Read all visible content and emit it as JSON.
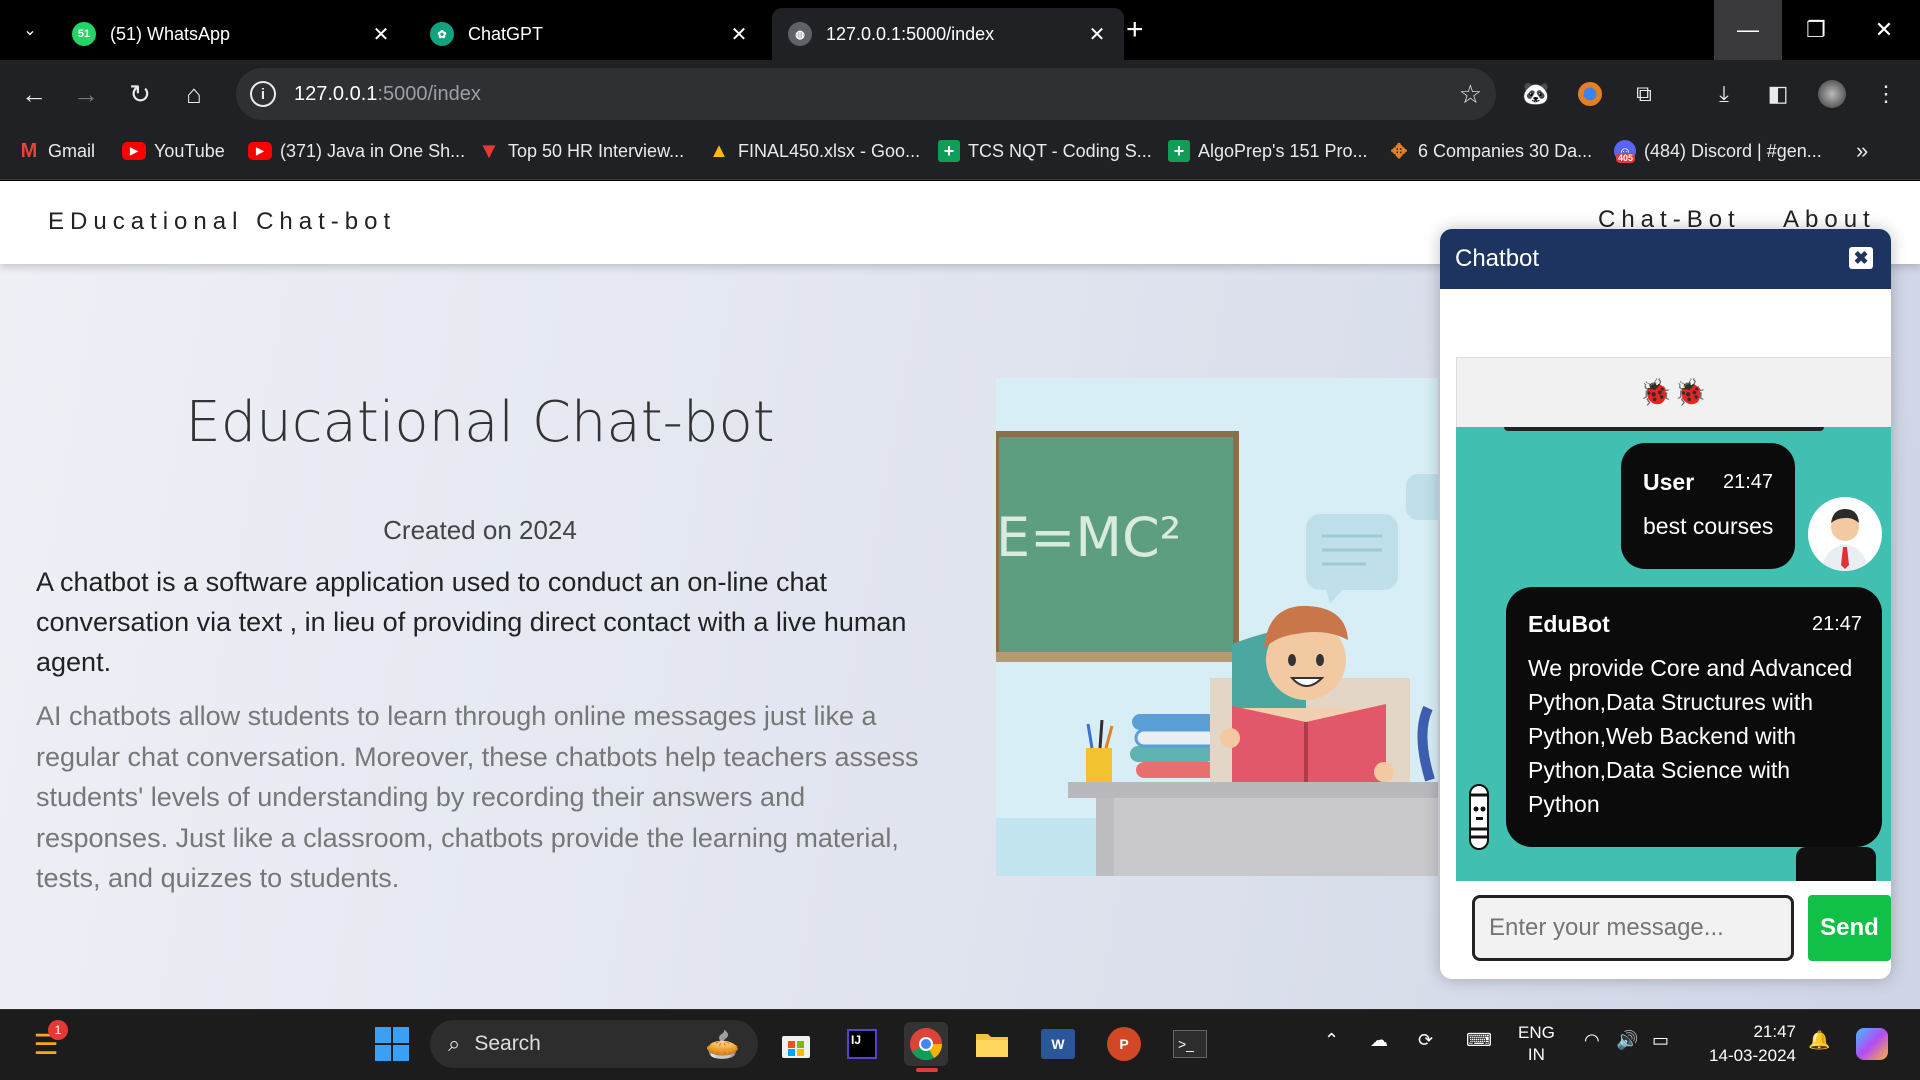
{
  "browser": {
    "tabs": [
      {
        "title": "(51) WhatsApp",
        "favicon": "whatsapp-icon",
        "badge": "51",
        "active": false
      },
      {
        "title": "ChatGPT",
        "favicon": "chatgpt-icon",
        "active": false
      },
      {
        "title": "127.0.0.1:5000/index",
        "favicon": "globe-icon",
        "active": true
      }
    ],
    "address": {
      "host": "127.0.0.1",
      "path": ":5000/index"
    },
    "bookmarks": [
      {
        "label": "Gmail",
        "icon": "gmail-icon",
        "color": "#ea4335"
      },
      {
        "label": "YouTube",
        "icon": "youtube-icon",
        "color": "#ff0000"
      },
      {
        "label": "(371) Java in One Sh...",
        "icon": "youtube-icon",
        "color": "#ff0000"
      },
      {
        "label": "Top 50 HR Interview...",
        "icon": "triangle-icon",
        "color": "#e53935"
      },
      {
        "label": "FINAL450.xlsx - Goo...",
        "icon": "drive-icon",
        "color": "#fbbc04"
      },
      {
        "label": "TCS NQT - Coding S...",
        "icon": "sheets-icon",
        "color": "#0f9d58"
      },
      {
        "label": "AlgoPrep's 151 Pro...",
        "icon": "sheets-icon",
        "color": "#0f9d58"
      },
      {
        "label": "6 Companies 30 Da...",
        "icon": "puzzle-icon",
        "color": "#e67e22"
      },
      {
        "label": "(484) Discord | #gen...",
        "icon": "discord-icon",
        "color": "#5865f2",
        "badge": "405"
      }
    ]
  },
  "site": {
    "brand": "EDucational Chat-bot",
    "nav": [
      "Chat-Bot",
      "About"
    ],
    "hero": {
      "title": "Educational Chat-bot",
      "date": "Created on 2024",
      "para1": "A chatbot is a software application used to conduct an on-line chat conversation via text , in lieu of providing direct contact with a live human agent.",
      "para2": "AI chatbots allow students to learn through online messages just like a regular chat conversation. Moreover, these chatbots help teachers assess students' levels of understanding by recording their answers and responses. Just like a classroom, chatbots provide the learning material, tests, and quizzes to students."
    },
    "illustration": {
      "board_text": "E=MC²"
    }
  },
  "chatbot": {
    "title": "Chatbot",
    "subheader_icons": "🐞🐞",
    "messages": [
      {
        "sender": "User",
        "time": "21:47",
        "text": "best courses"
      },
      {
        "sender": "EduBot",
        "time": "21:47",
        "text": "We provide Core and Advanced Python,Data Structures with Python,Web Backend with Python,Data Science with Python"
      }
    ],
    "input_placeholder": "Enter your message...",
    "send_label": "Send"
  },
  "taskbar": {
    "search_label": "Search",
    "widgets_badge": "1",
    "lang_top": "ENG",
    "lang_bottom": "IN",
    "time": "21:47",
    "date": "14-03-2024"
  },
  "colors": {
    "chat_header": "#1d3461",
    "chat_body": "#41bfb0",
    "send_button": "#11c046"
  }
}
